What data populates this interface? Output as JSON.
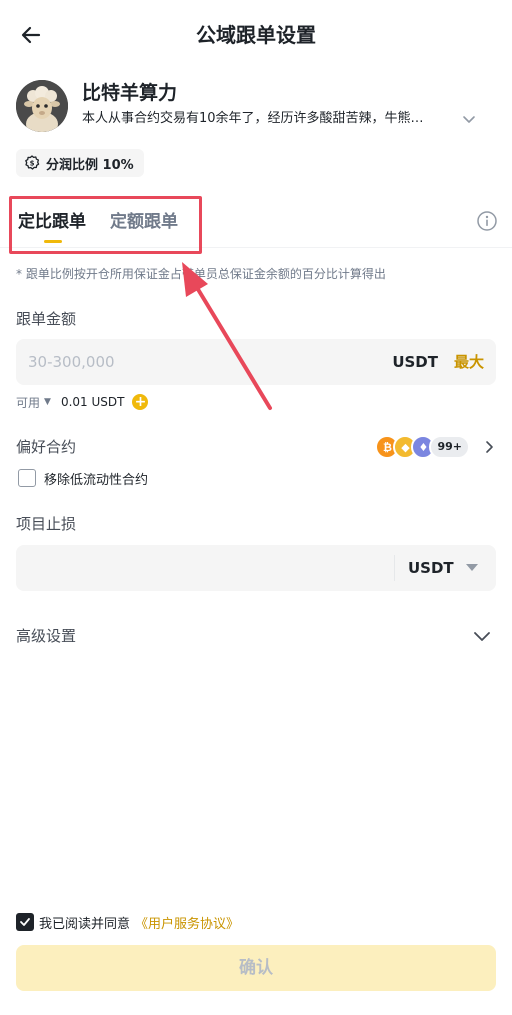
{
  "header": {
    "title": "公域跟单设置"
  },
  "trader": {
    "name": "比特羊算力",
    "description": "本人从事合约交易有10余年了，经历许多酸甜苦辣，牛熊…",
    "profit_share": "分润比例 10%"
  },
  "tabs": [
    {
      "label": "定比跟单",
      "active": true
    },
    {
      "label": "定额跟单",
      "active": false
    }
  ],
  "note": "* 跟单比例按开仓所用保证金占带单员总保证金余额的百分比计算得出",
  "amount": {
    "label": "跟单金额",
    "placeholder": "30-300,000",
    "unit": "USDT",
    "max_label": "最大"
  },
  "available": {
    "label": "可用",
    "value": "0.01 USDT"
  },
  "preference": {
    "label": "偏好合约",
    "more_count": "99+",
    "remove_low_liquidity_label": "移除低流动性合约"
  },
  "stop_loss": {
    "label": "项目止损",
    "unit": "USDT"
  },
  "advanced": {
    "label": "高级设置"
  },
  "agreement": {
    "text": "我已阅读并同意",
    "link": "《用户服务协议》",
    "checked": true
  },
  "confirm": {
    "label": "确认"
  },
  "colors": {
    "accent": "#f0b90b",
    "link": "#c99400",
    "highlight": "#e8485a",
    "confirm_disabled_bg": "#fcefbe"
  }
}
